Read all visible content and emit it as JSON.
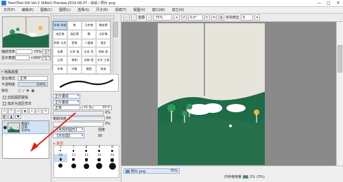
{
  "window": {
    "title": "PaintTool SAI Ver.2 (64bit) Preview.2019.08.07 - 绘绘 / 照片.png",
    "minimize": "—",
    "maximize": "□",
    "close": "✕"
  },
  "menu": [
    "文件(F)",
    "编辑(E)",
    "图像(C)",
    "图层(L)",
    "选择(S)",
    "尺子(R)",
    "滤镜(T)",
    "视图(V)",
    "窗口(W)",
    "其它(O)"
  ],
  "toolbar": {
    "selection_label": "选择",
    "zoom": "75%",
    "angle": "0.0°",
    "stabilizer_label": "手抖修正",
    "stabilizer_value": "6"
  },
  "navigator": {
    "zoom_label": "缩放倍率",
    "zoom_value": "75%",
    "angle_label": "显示角度",
    "angle_value": "+000°"
  },
  "layer_props": {
    "header": "特殊效果",
    "blend_label": "混合模式",
    "blend_value": "正常",
    "opacity_label": "不透明度",
    "opacity_value": "100%",
    "lock_label": "锁定",
    "clip_label": "剪贴图层蒙版",
    "select_source_label": "指定为选区样本"
  },
  "layer": {
    "name": "图层1",
    "mode": "正常",
    "opacity": "100%"
  },
  "tools": [
    {
      "label": "铅笔 喷枪",
      "selected": true
    },
    {
      "label": "笔",
      "selected": false
    },
    {
      "label": "马克笔",
      "selected": false
    },
    {
      "label": "橡皮擦",
      "selected": false
    },
    {
      "label": "选区笔",
      "selected": false
    },
    {
      "label": "选区擦",
      "selected": false
    },
    {
      "label": "桶",
      "selected": false
    },
    {
      "label": "水彩笔",
      "selected": false
    },
    {
      "label": "和纸 马克",
      "selected": false
    },
    {
      "label": "宽笔",
      "selected": false
    },
    {
      "label": "二值笔",
      "selected": false
    },
    {
      "label": "指尖",
      "selected": false
    },
    {
      "label": "金属",
      "selected": false
    },
    {
      "label": "分享 笔",
      "selected": false
    },
    {
      "label": "水彩 色",
      "selected": false
    },
    {
      "label": "喷枪 柔",
      "selected": false
    },
    {
      "label": "工具",
      "selected": false
    },
    {
      "label": "笔刷",
      "selected": false
    },
    {
      "label": "选取 框",
      "selected": false
    },
    {
      "label": "文字 工具",
      "selected": false
    },
    {
      "label": "灰笔",
      "selected": false
    },
    {
      "label": "对象",
      "selected": false
    },
    {
      "label": "描图",
      "selected": false
    },
    {
      "label": "渐变",
      "selected": false
    }
  ],
  "brush": {
    "mode_a": "正片叠底",
    "mode_b": "正片叠底",
    "mode_c": "正常",
    "size_mult": "x1.0",
    "size_value": "10.0",
    "min_size": "0%",
    "density_label": "笔刷浓度",
    "density_value": "64",
    "texture_label": "【常规的圆形】",
    "texture_value": "强度",
    "texture2_label": "【无纹理】",
    "texture2_value": "95",
    "misc_header": "其他",
    "sizes": [
      "5",
      "7",
      "8",
      "9",
      "8",
      "10",
      "12",
      "14",
      "16",
      "20",
      "20",
      "25",
      "30",
      "35",
      "40"
    ]
  },
  "status": {
    "filename": "照片.png",
    "zoom": "75%",
    "memory_label": "内存使用量",
    "memory_value": "2%",
    "memory_pct2": "(3%)"
  }
}
